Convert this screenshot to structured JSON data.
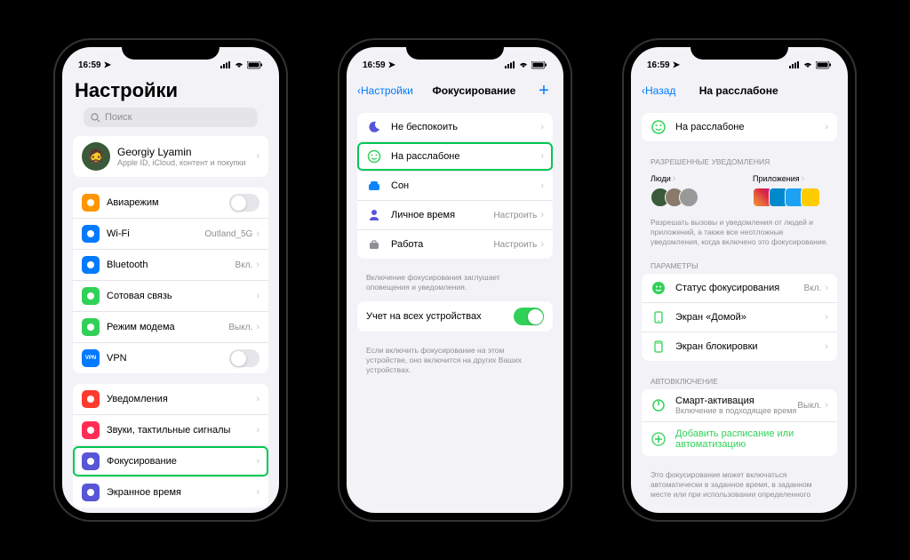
{
  "status": {
    "time": "16:59"
  },
  "phone1": {
    "title": "Настройки",
    "search": "Поиск",
    "profile": {
      "name": "Georgiy Lyamin",
      "sub": "Apple ID, iCloud, контент и покупки"
    },
    "g1": [
      {
        "label": "Авиарежим",
        "color": "#ff9500",
        "toggle": true,
        "on": false
      },
      {
        "label": "Wi-Fi",
        "color": "#007aff",
        "value": "Outland_5G"
      },
      {
        "label": "Bluetooth",
        "color": "#007aff",
        "value": "Вкл."
      },
      {
        "label": "Сотовая связь",
        "color": "#30d158",
        "value": ""
      },
      {
        "label": "Режим модема",
        "color": "#30d158",
        "value": "Выкл."
      },
      {
        "label": "VPN",
        "color": "#007aff",
        "toggle": true,
        "on": false,
        "badge": "VPN"
      }
    ],
    "g2": [
      {
        "label": "Уведомления",
        "color": "#ff3b30"
      },
      {
        "label": "Звуки, тактильные сигналы",
        "color": "#ff2d55"
      },
      {
        "label": "Фокусирование",
        "color": "#5856d6",
        "hl": true
      },
      {
        "label": "Экранное время",
        "color": "#5856d6"
      }
    ]
  },
  "phone2": {
    "back": "Настройки",
    "title": "Фокусирование",
    "items": [
      {
        "label": "Не беспокоить",
        "color": "#5856d6"
      },
      {
        "label": "На расслабоне",
        "color": "#30d158",
        "hl": true
      },
      {
        "label": "Сон",
        "color": "#0a84ff"
      },
      {
        "label": "Личное время",
        "color": "#5856d6",
        "value": "Настроить"
      },
      {
        "label": "Работа",
        "color": "#8e8e93",
        "value": "Настроить"
      }
    ],
    "footer1": "Включение фокусирования заглушает оповещения и уведомления.",
    "share": "Учет на всех устройствах",
    "footer2": "Если включить фокусирование на этом устройстве, оно включится на других Ваших устройствах."
  },
  "phone3": {
    "back": "Назад",
    "title": "На расслабоне",
    "topItem": "На расслабоне",
    "allowHeader": "РАЗРЕШЕННЫЕ УВЕДОМЛЕНИЯ",
    "people": "Люди",
    "apps": "Приложения",
    "allowFooter": "Разрешать вызовы и уведомления от людей и приложений, а также все неотложные уведомления, когда включено это фокусирование.",
    "paramsHeader": "ПАРАМЕТРЫ",
    "params": [
      {
        "label": "Статус фокусирования",
        "value": "Вкл.",
        "color": "#30d158"
      },
      {
        "label": "Экран «Домой»",
        "color": "#30d158"
      },
      {
        "label": "Экран блокировки",
        "color": "#30d158"
      }
    ],
    "autoHeader": "АВТОВКЛЮЧЕНИЕ",
    "smart": {
      "label": "Смарт-активация",
      "sub": "Включение в подходящее время",
      "value": "Выкл."
    },
    "addSchedule": "Добавить расписание или автоматизацию",
    "autoFooter": "Это фокусирование может включаться автоматически в заданное время, в заданном месте или при использовании определенного"
  }
}
